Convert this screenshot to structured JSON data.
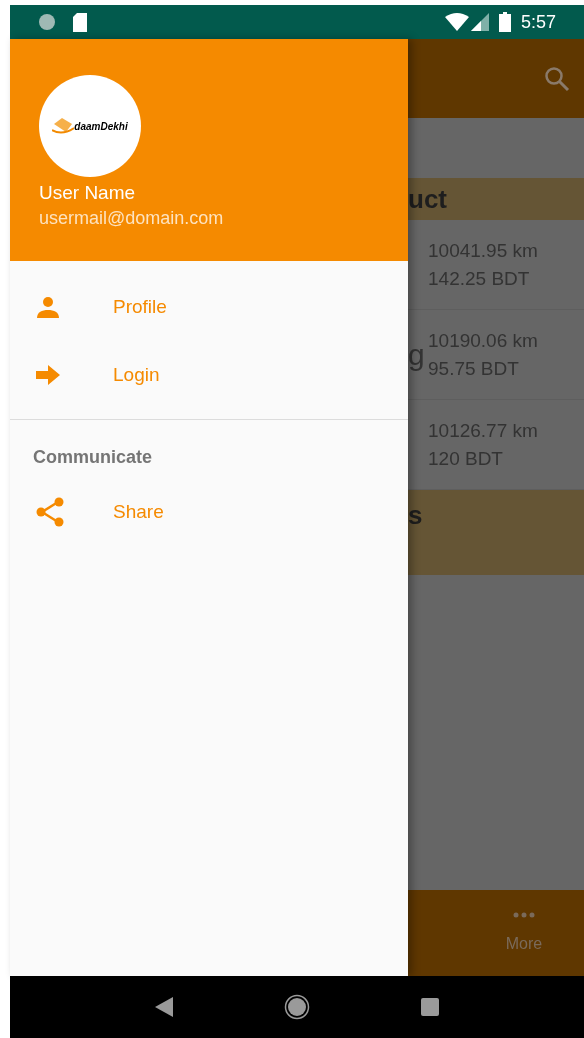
{
  "status_bar": {
    "time": "5:57"
  },
  "drawer": {
    "header": {
      "logo_text": "daamDekhi",
      "user_name": "User Name",
      "email": "usermail@domain.com"
    },
    "items": [
      {
        "kind": "person",
        "label": "Profile"
      },
      {
        "kind": "arrow",
        "label": "Login"
      }
    ],
    "section": {
      "title": "Communicate",
      "items": [
        {
          "kind": "share",
          "label": "Share"
        }
      ]
    }
  },
  "background": {
    "section_headers": [
      "uct",
      "s"
    ],
    "rows": [
      {
        "column_1": "",
        "distance": "10041.95 km",
        "price": "142.25 BDT"
      },
      {
        "column_1": "g",
        "distance": "10190.06 km",
        "price": "95.75 BDT"
      },
      {
        "column_1": "",
        "distance": "10126.77 km",
        "price": "120 BDT"
      }
    ],
    "bottom_nav": {
      "label": "More"
    }
  }
}
